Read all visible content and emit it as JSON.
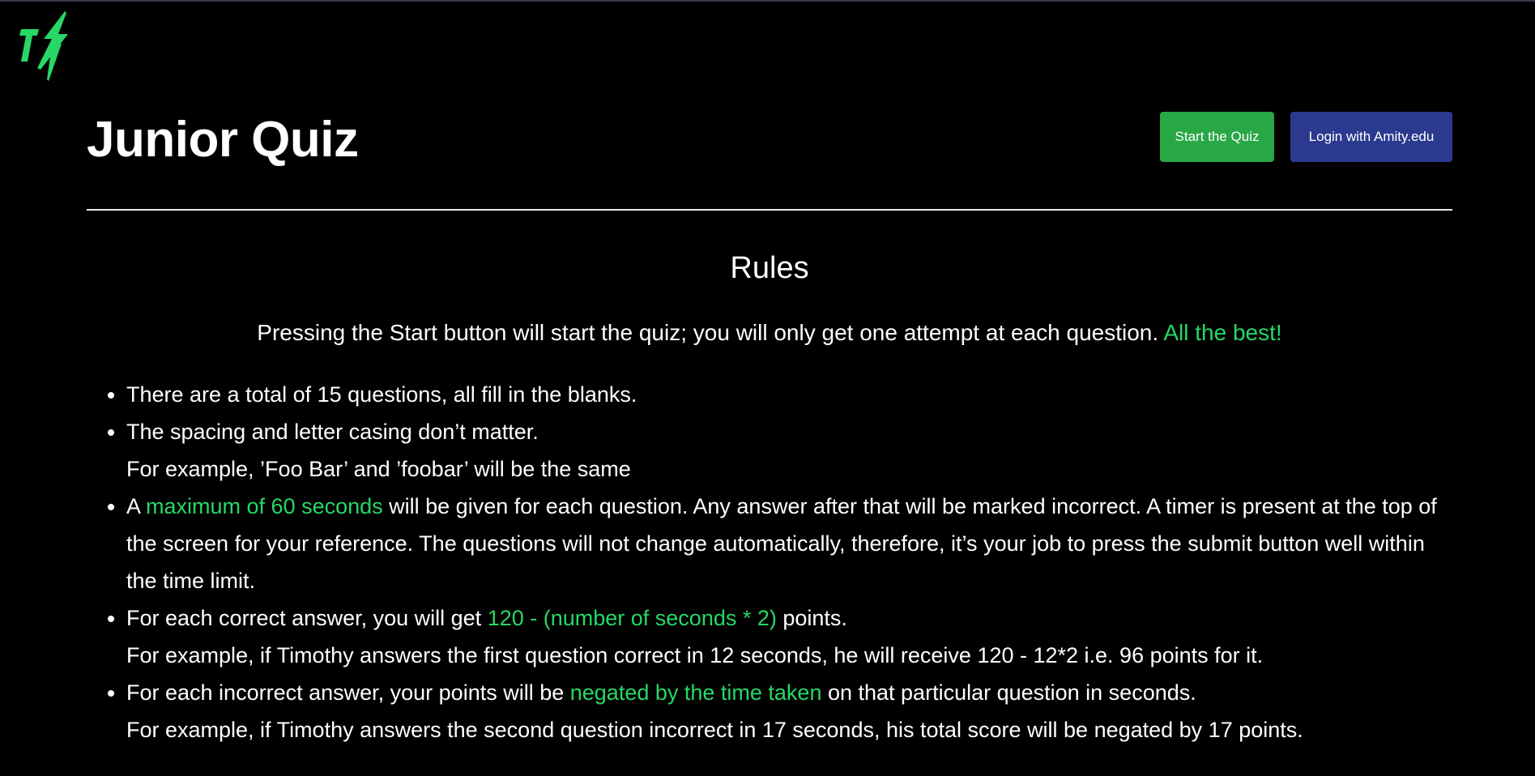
{
  "brand": {
    "logo_icon": "lightning-bolt-logo-icon",
    "accent_color": "#28d766"
  },
  "header": {
    "title": "Junior Quiz",
    "start_button": "Start the Quiz",
    "login_button": "Login with Amity.edu",
    "start_color": "#28a745",
    "login_color": "#2b3a8f"
  },
  "rules": {
    "heading": "Rules",
    "intro_text": "Pressing the Start button will start the quiz; you will only get one attempt at each question. ",
    "intro_highlight": "All the best!",
    "item1": "There are a total of 15 questions, all fill in the blanks.",
    "item2_line1": "The spacing and letter casing don’t matter.",
    "item2_line2": "For example, ’Foo Bar’ and ’foobar’ will be the same",
    "item3_prefix": "A ",
    "item3_highlight": "maximum of 60 seconds",
    "item3_suffix": " will be given for each question. Any answer after that will be marked incorrect. A timer is present at the top of the screen for your reference. The questions will not change automatically, therefore, it’s your job to press the submit button well within the time limit.",
    "item4_prefix": "For each correct answer, you will get ",
    "item4_highlight": "120 - (number of seconds * 2)",
    "item4_suffix": " points.",
    "item4_example": "For example, if Timothy answers the first question correct in 12 seconds, he will receive 120 - 12*2 i.e. 96 points for it.",
    "item5_prefix": "For each incorrect answer, your points will be ",
    "item5_highlight": "negated by the time taken",
    "item5_suffix": " on that particular question in seconds.",
    "item5_example": "For example, if Timothy answers the second question incorrect in 17 seconds, his total score will be negated by 17 points."
  }
}
